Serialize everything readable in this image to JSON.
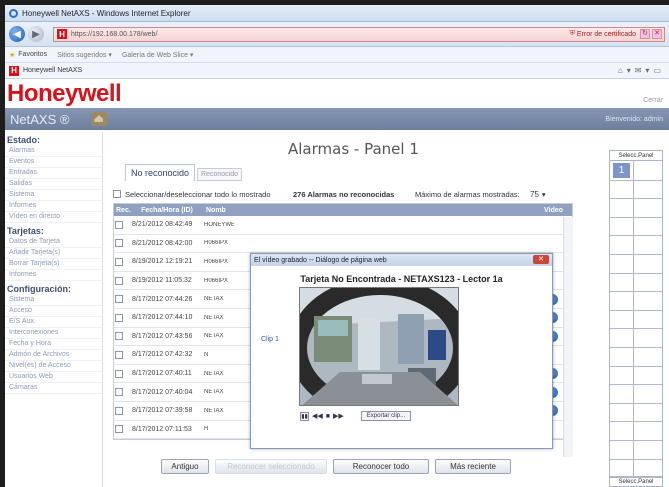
{
  "browser": {
    "title": "Honeywell NetAXS - Windows Internet Explorer",
    "url": "https://192.168.00.178/web/",
    "cert_error": "Error de certificado",
    "favorites_label": "Favoritos",
    "fav_items": [
      "Sitios sugeridos ▾",
      "Galería de Web Slice ▾"
    ],
    "tab_label": "Honeywell NetAXS"
  },
  "header": {
    "logo": "Honeywell",
    "close": "Cerrar",
    "app_name": "NetAXS ®",
    "welcome": "Bienvenido: admin"
  },
  "sidebar": {
    "sections": [
      {
        "title": "Estado:",
        "items": [
          "Alarmas",
          "Eventos",
          "Entradas",
          "Salidas",
          "Sistema",
          "Informes",
          "Vídeo en directo"
        ]
      },
      {
        "title": "Tarjetas:",
        "items": [
          "Datos de Tarjeta",
          "Añadir Tarjeta(s)",
          "Borrar Tarjeta(s)",
          "Informes"
        ]
      },
      {
        "title": "Configuración:",
        "items": [
          "Sistema",
          "Acceso",
          "E/S Aux.",
          "Interconexiones",
          "Fecha y Hora",
          "Admón de Archivos",
          "Nivel(es) de Acceso",
          "Usuarios Web",
          "Cámaras"
        ]
      }
    ]
  },
  "main": {
    "title": "Alarmas - Panel 1",
    "tabs": [
      "No reconocido",
      "Reconocido"
    ],
    "select_all": "Seleccionar/deseleccionar todo lo mostrado",
    "count_text": "276 Alarmas no reconocidas",
    "max_label": "Máximo de alarmas mostradas:",
    "max_value": "75",
    "columns": [
      "Rec.",
      "Fecha/Hora (ID)",
      "Nomb"
    ],
    "video_col": "Vídeo",
    "rows": [
      {
        "date": "8/21/2012 08:42:49",
        "name": "HONEYWELL"
      },
      {
        "date": "8/21/2012 08:42:00",
        "name": "H066IPX"
      },
      {
        "date": "8/19/2012 12:19:21",
        "name": "H066IPX"
      },
      {
        "date": "8/19/2012 11:05:32",
        "name": "H066IPX"
      },
      {
        "date": "8/17/2012 07:44:26",
        "name": "NETAX"
      },
      {
        "date": "8/17/2012 07:44:10",
        "name": "NETAX"
      },
      {
        "date": "8/17/2012 07:43:56",
        "name": "NETAX"
      },
      {
        "date": "8/17/2012 07:42:32",
        "name": "N"
      },
      {
        "date": "8/17/2012 07:40:11",
        "name": "NETAX"
      },
      {
        "date": "8/17/2012 07:40:04",
        "name": "NETAX"
      },
      {
        "date": "8/17/2012 07:39:58",
        "name": "NETAX"
      },
      {
        "date": "8/17/2012 07:11:53",
        "name": "H"
      }
    ],
    "buttons": [
      "Antiguo",
      "Reconocer seleccionado",
      "Reconocer todo",
      "Más reciente"
    ]
  },
  "right_panel": {
    "header": "Selecc.Panel",
    "selected": "1",
    "footer": "Selecc.Panel"
  },
  "dialog": {
    "title": "El vídeo grabado -- Diálogo de página web",
    "heading": "Tarjeta No Encontrada - NETAXS123 - Lector 1a",
    "clip": "Clip 1",
    "export": "Exportar clip..."
  }
}
